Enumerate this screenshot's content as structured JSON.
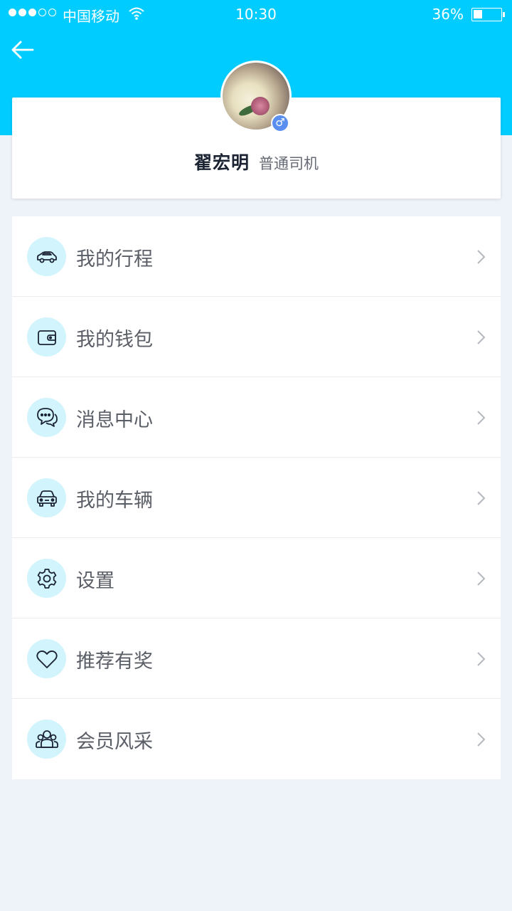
{
  "status_bar": {
    "carrier": "中国移动",
    "time": "10:30",
    "battery_percent": "36%",
    "battery_level": 0.36
  },
  "profile": {
    "name": "翟宏明",
    "role": "普通司机",
    "gender_symbol": "♂"
  },
  "menu": {
    "items": [
      {
        "label": "我的行程",
        "icon": "car-icon"
      },
      {
        "label": "我的钱包",
        "icon": "wallet-icon"
      },
      {
        "label": "消息中心",
        "icon": "chat-icon"
      },
      {
        "label": "我的车辆",
        "icon": "vehicle-icon"
      },
      {
        "label": "设置",
        "icon": "gear-icon"
      },
      {
        "label": "推荐有奖",
        "icon": "heart-icon"
      },
      {
        "label": "会员风采",
        "icon": "members-icon"
      }
    ]
  },
  "colors": {
    "header": "#00ccff",
    "page_bg": "#eef2f9",
    "icon_bg": "#d1f4fd",
    "icon_stroke": "#1c2434",
    "badge": "#5a8ff0"
  }
}
